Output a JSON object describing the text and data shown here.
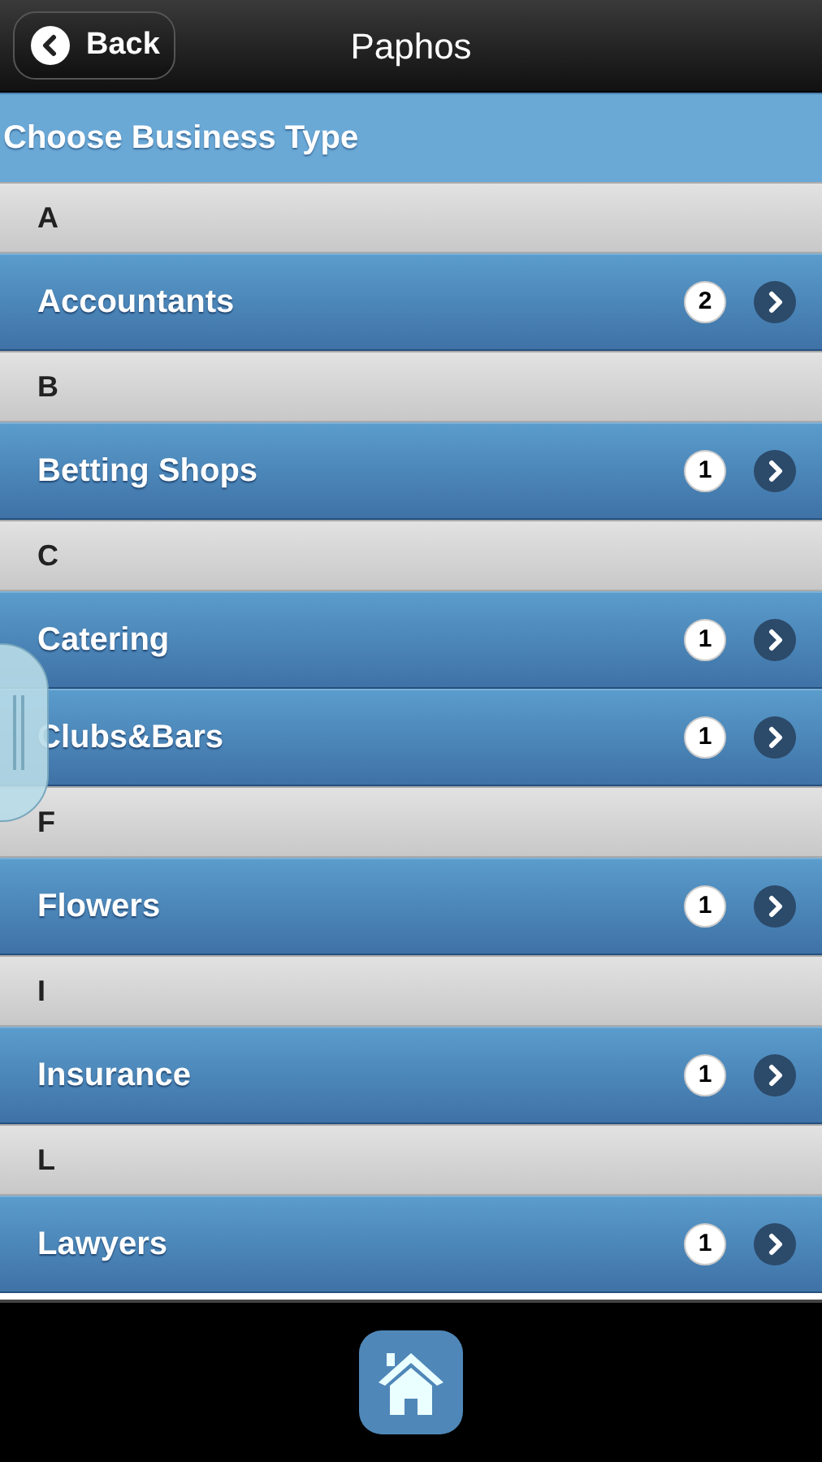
{
  "header": {
    "back_label": "Back",
    "title": "Paphos"
  },
  "heading": "Choose Business Type",
  "sections": [
    {
      "letter": "A",
      "items": [
        {
          "label": "Accountants",
          "count": "2"
        }
      ]
    },
    {
      "letter": "B",
      "items": [
        {
          "label": "Betting Shops",
          "count": "1"
        }
      ]
    },
    {
      "letter": "C",
      "items": [
        {
          "label": "Catering",
          "count": "1"
        },
        {
          "label": "Clubs&Bars",
          "count": "1"
        }
      ]
    },
    {
      "letter": "F",
      "items": [
        {
          "label": "Flowers",
          "count": "1"
        }
      ]
    },
    {
      "letter": "I",
      "items": [
        {
          "label": "Insurance",
          "count": "1"
        }
      ]
    },
    {
      "letter": "L",
      "items": [
        {
          "label": "Lawyers",
          "count": "1"
        }
      ]
    }
  ]
}
